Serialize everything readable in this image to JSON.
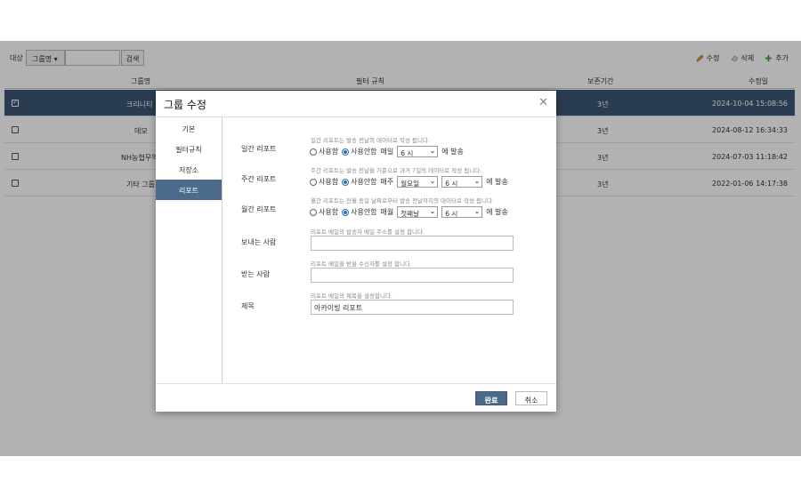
{
  "toolbar": {
    "target_label": "대상",
    "group_select": "그룹명",
    "search_value": "",
    "search_button": "검색",
    "actions": {
      "edit": "수정",
      "delete": "삭제",
      "add": "추가"
    }
  },
  "grid": {
    "columns": [
      "그룹명",
      "필터 규칙",
      "보존기간",
      "수정일"
    ],
    "rows": [
      {
        "name": "크리니티",
        "keep": "3년",
        "modified": "2024-10-04 15:08:56",
        "checked": true
      },
      {
        "name": "데모",
        "keep": "3년",
        "modified": "2024-08-12 16:34:33",
        "checked": false
      },
      {
        "name": "NH농협무역",
        "keep": "3년",
        "modified": "2024-07-03 11:18:42",
        "checked": false
      },
      {
        "name": "기타 그룹",
        "keep": "3년",
        "modified": "2022-01-06 14:17:38",
        "checked": false
      }
    ]
  },
  "modal": {
    "title": "그룹 수정",
    "nav": [
      "기본",
      "필터규칙",
      "저장소",
      "리포트"
    ],
    "active_nav": "리포트",
    "daily": {
      "label": "일간 리포트",
      "hint": "일간 리포트는 발송 전날의 데이터로 작성 됩니다.",
      "opt_use": "사용함",
      "opt_nouse": "사용안함",
      "selected": "사용안함",
      "freq": "매일",
      "hour": "6 시",
      "suffix": "에 발송"
    },
    "weekly": {
      "label": "주간 리포트",
      "hint": "주간 리포트는 발송 전날을 기준으로 과거 7일의 데이터로 작성 됩니다.",
      "opt_use": "사용함",
      "opt_nouse": "사용안함",
      "selected": "사용안함",
      "freq": "매주",
      "day": "월요일",
      "hour": "6 시",
      "suffix": "에 발송"
    },
    "monthly": {
      "label": "월간 리포트",
      "hint": "월간 리포트는 전월 동일 날짜로부터 발송 전날까지의 데이터로 작성 됩니다.",
      "opt_use": "사용함",
      "opt_nouse": "사용안함",
      "selected": "사용안함",
      "freq": "매월",
      "day": "첫째날",
      "hour": "6 시",
      "suffix": "에 발송"
    },
    "sender": {
      "label": "보내는 사람",
      "hint": "리포트 메일의 발송자 메일 주소를 설정 합니다.",
      "value": ""
    },
    "receiver": {
      "label": "받는 사람",
      "hint": "리포트 메일을 받을 수신자를 설정 합니다.",
      "value": ""
    },
    "subject": {
      "label": "제목",
      "hint": "리포트 메일의 제목을 설정합니다.",
      "value": "아카이빙 리포트"
    },
    "ok": "완료",
    "cancel": "취소"
  }
}
